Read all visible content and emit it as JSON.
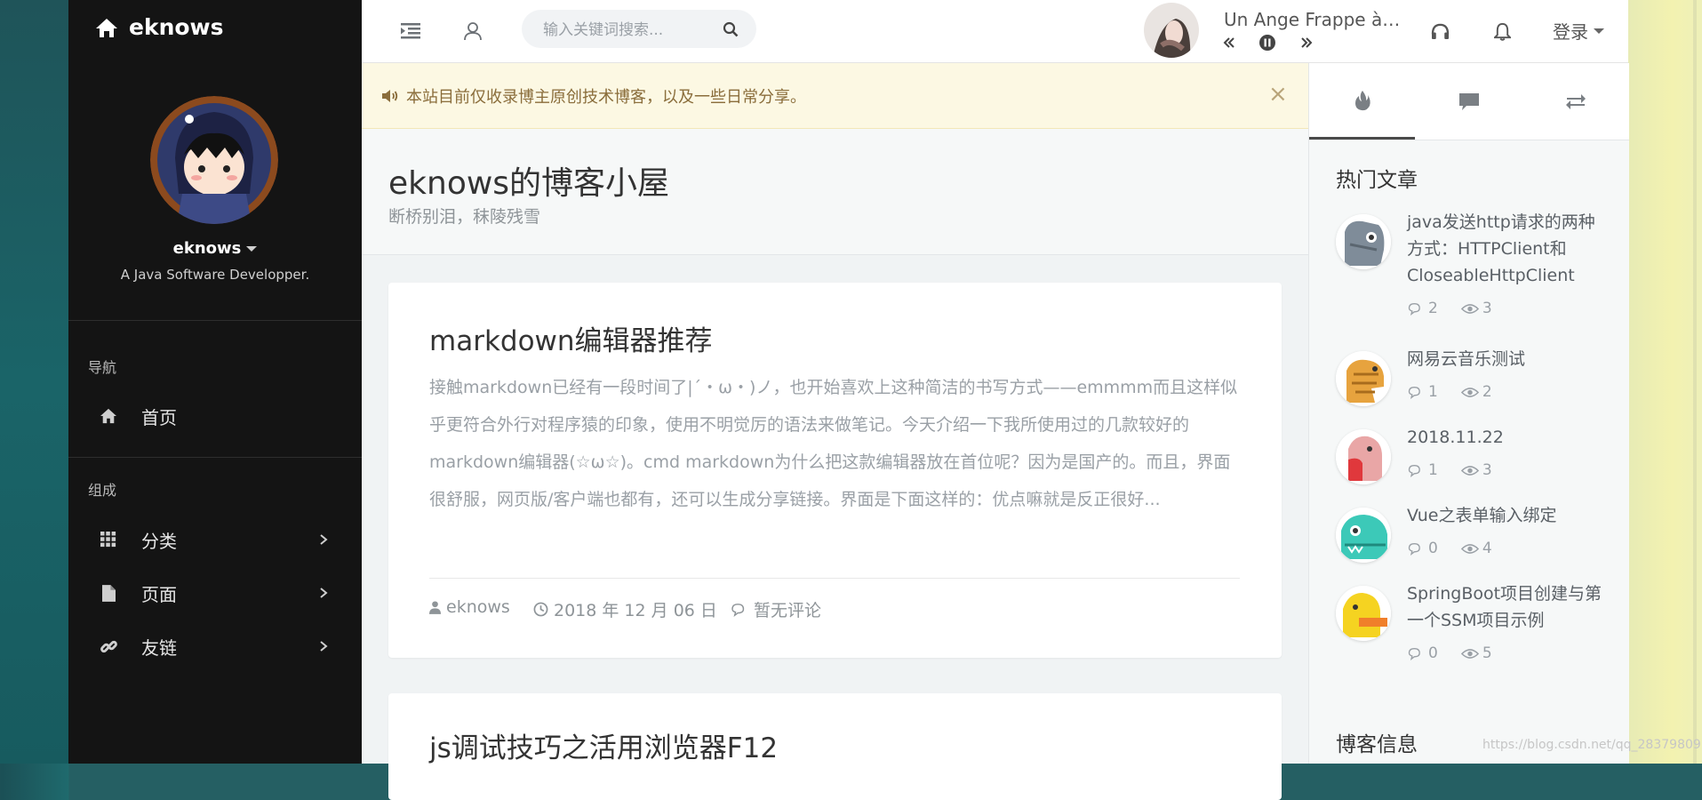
{
  "brand": {
    "name": "eknows"
  },
  "profile": {
    "username": "eknows",
    "tagline": "A Java Software Developper."
  },
  "sidebar": {
    "sections": [
      {
        "heading": "导航",
        "items": [
          {
            "label": "首页",
            "icon": "home-icon"
          }
        ]
      },
      {
        "heading": "组成",
        "items": [
          {
            "label": "分类",
            "icon": "grid-icon"
          },
          {
            "label": "页面",
            "icon": "file-icon"
          },
          {
            "label": "友链",
            "icon": "link-icon"
          }
        ]
      }
    ]
  },
  "header": {
    "search_placeholder": "输入关键词搜索...",
    "song_title": "Un Ange Frappe à Ma Porte",
    "login_label": "登录"
  },
  "notice": {
    "text": "本站目前仅收录博主原创技术博客，以及一些日常分享。",
    "close": "×"
  },
  "site": {
    "title": "eknows的博客小屋",
    "subtitle": "断桥别泪，秣陵残雪"
  },
  "posts": [
    {
      "title": "markdown编辑器推荐",
      "excerpt": "接触markdown已经有一段时间了|´・ω・)ノ，也开始喜欢上这种简洁的书写方式——emmmm而且这样似乎更符合外行对程序猿的印象，使用不明觉厉的语法来做笔记。今天介绍一下我所使用过的几款较好的markdown编辑器(☆ω☆)。cmd markdown为什么把这款编辑器放在首位呢？因为是国产的。而且，界面很舒服，网页版/客户端也都有，还可以生成分享链接。界面是下面这样的：优点嘛就是反正很好...",
      "author": "eknows",
      "date": "2018 年 12 月 06 日",
      "comments": "暂无评论"
    },
    {
      "title": "js调试技巧之活用浏览器F12"
    }
  ],
  "right_panel": {
    "tabs": [
      "fire-icon",
      "comment-icon",
      "exchange-icon"
    ],
    "hot_title": "热门文章",
    "hot_posts": [
      {
        "title": "java发送http请求的两种方式：HTTPClient和CloseableHttpClient",
        "comments": "2",
        "views": "3",
        "avatar_color": "#7f8c99"
      },
      {
        "title": "网易云音乐测试",
        "comments": "1",
        "views": "2",
        "avatar_color": "#e7a33e"
      },
      {
        "title": "2018.11.22",
        "comments": "1",
        "views": "3",
        "avatar_color": "#e9a6a6"
      },
      {
        "title": "Vue之表单输入绑定",
        "comments": "0",
        "views": "4",
        "avatar_color": "#3cc9b8"
      },
      {
        "title": "SpringBoot项目创建与第一个SSM项目示例",
        "comments": "0",
        "views": "5",
        "avatar_color": "#f5d321"
      }
    ],
    "info_title": "博客信息"
  },
  "watermark": "https://blog.csdn.net/qq_28379809"
}
